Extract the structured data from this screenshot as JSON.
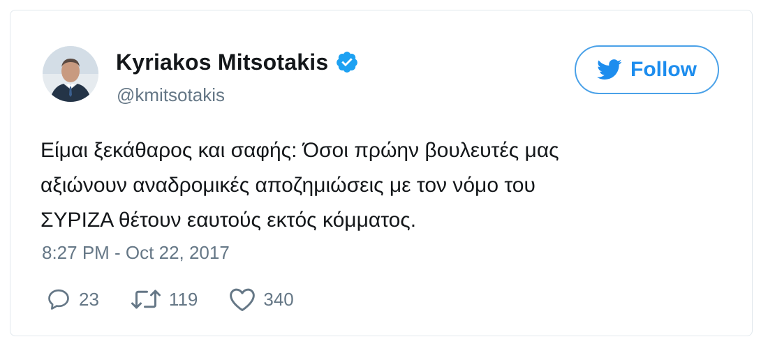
{
  "user": {
    "display_name": "Kyriakos Mitsotakis",
    "handle": "@kmitsotakis",
    "verified_icon": "verified-badge-icon",
    "avatar_icon": "profile-photo"
  },
  "follow_button": {
    "label": "Follow",
    "icon": "twitter-bird-icon"
  },
  "tweet": {
    "text": "Είμαι ξεκάθαρος και σαφής: Όσοι πρώην βουλευτές μας\nαξιώνουν αναδρομικές αποζημιώσεις με τον νόμο του\nΣΥΡΙΖΑ θέτουν εαυτούς εκτός κόμματος.",
    "timestamp": "8:27 PM - Oct 22, 2017"
  },
  "actions": {
    "replies": {
      "icon": "reply-icon",
      "count": "23"
    },
    "retweets": {
      "icon": "retweet-icon",
      "count": "119"
    },
    "likes": {
      "icon": "heart-icon",
      "count": "340"
    }
  },
  "colors": {
    "accent": "#1d8dee",
    "verified": "#1da1f2",
    "text": "#14171a",
    "muted": "#657786",
    "border": "#e1e8ed"
  }
}
